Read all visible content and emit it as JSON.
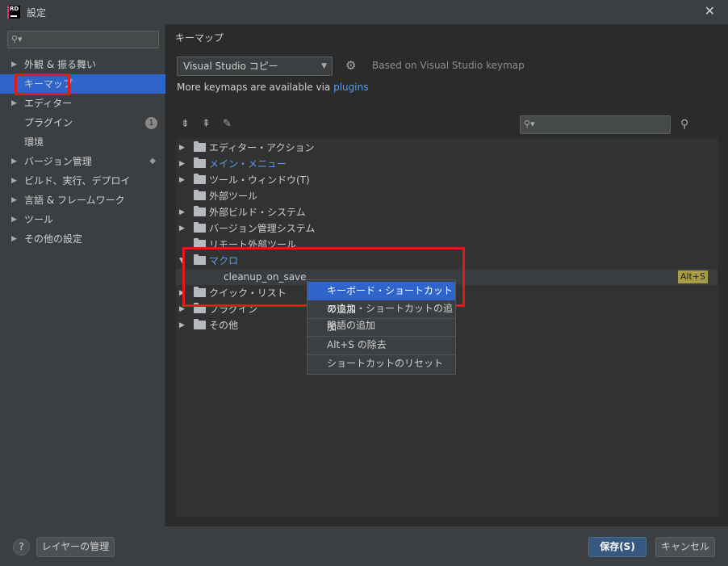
{
  "window": {
    "title": "設定",
    "close": "✕",
    "logo_text": "RD"
  },
  "sidebar": {
    "items": [
      {
        "label": "外観 & 振る舞い",
        "expandable": true
      },
      {
        "label": "キーマップ",
        "expandable": false,
        "selected": true
      },
      {
        "label": "エディター",
        "expandable": true
      },
      {
        "label": "プラグイン",
        "expandable": false,
        "badge": "1"
      },
      {
        "label": "環境",
        "expandable": false
      },
      {
        "label": "バージョン管理",
        "expandable": true
      },
      {
        "label": "ビルド、実行、デプロイ",
        "expandable": true
      },
      {
        "label": "言語 & フレームワーク",
        "expandable": true
      },
      {
        "label": "ツール",
        "expandable": true
      },
      {
        "label": "その他の設定",
        "expandable": true
      }
    ]
  },
  "main": {
    "title": "キーマップ",
    "keymap_select_value": "Visual Studio コピー",
    "based_on": "Based on Visual Studio keymap",
    "more_text": "More keymaps are available via ",
    "plugins_link": "plugins"
  },
  "tree": {
    "rows": [
      {
        "label": "エディター・アクション",
        "caret": "▶",
        "blue": false
      },
      {
        "label": "メイン・メニュー",
        "caret": "▶",
        "blue": true
      },
      {
        "label": "ツール・ウィンドウ(T)",
        "caret": "▶",
        "blue": false
      },
      {
        "label": "外部ツール",
        "caret": "",
        "blue": false
      },
      {
        "label": "外部ビルド・システム",
        "caret": "▶",
        "blue": false
      },
      {
        "label": "バージョン管理システム",
        "caret": "▶",
        "blue": false
      },
      {
        "label": "リモート外部ツール",
        "caret": "",
        "blue": false
      },
      {
        "label": "マクロ",
        "caret": "▼",
        "blue": true
      },
      {
        "label": "cleanup_on_save",
        "caret": "",
        "blue": false,
        "child": true,
        "shortcut": "Alt+S"
      },
      {
        "label": "クイック・リスト",
        "caret": "▶",
        "blue": false
      },
      {
        "label": "プラグイン",
        "caret": "▶",
        "blue": false
      },
      {
        "label": "その他",
        "caret": "▶",
        "blue": false
      }
    ]
  },
  "context_menu": {
    "items": [
      "キーボード・ショートカットの追加",
      "マウス・ショートカットの追加",
      "略語の追加",
      "Alt+S の除去",
      "ショートカットのリセット"
    ]
  },
  "footer": {
    "help": "?",
    "manage_layers": "レイヤーの管理",
    "save": "保存(S)",
    "cancel": "キャンセル"
  }
}
